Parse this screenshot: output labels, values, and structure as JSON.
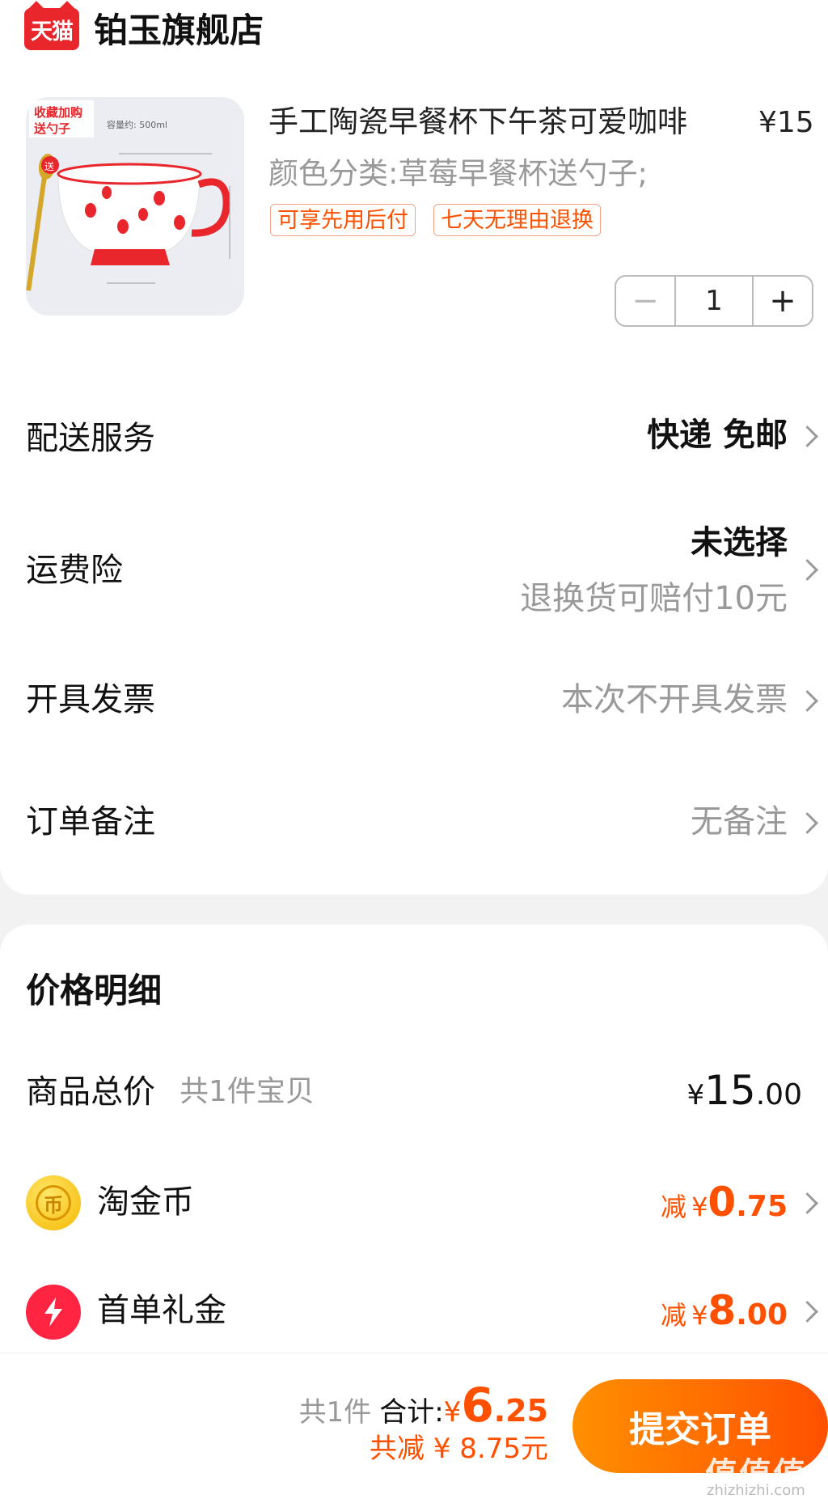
{
  "store": {
    "logo_text": "天猫",
    "name": "铂玉旗舰店"
  },
  "product": {
    "image_labels": {
      "promo": "收藏加购\n送勺子",
      "capacity": "容量约: 500ml",
      "gift": "送"
    },
    "title": "手工陶瓷早餐杯下午茶可爱咖啡",
    "price": "¥15",
    "sku": "颜色分类:草莓早餐杯送勺子;",
    "tags": [
      "可享先用后付",
      "七天无理由退换"
    ],
    "quantity": "1",
    "minus_label": "−",
    "plus_label": "+"
  },
  "rows": {
    "delivery": {
      "label": "配送服务",
      "value": "快递 免邮"
    },
    "insurance": {
      "label": "运费险",
      "value": "未选择",
      "sub": "退换货可赔付10元"
    },
    "invoice": {
      "label": "开具发票",
      "value": "本次不开具发票"
    },
    "remark": {
      "label": "订单备注",
      "value": "无备注"
    }
  },
  "price_detail": {
    "title": "价格明细",
    "total": {
      "label": "商品总价",
      "sub": "共1件宝贝",
      "symbol": "¥",
      "int": "15",
      "dec": ".00"
    },
    "coin": {
      "icon": "币",
      "label": "淘金币",
      "prefix": "减",
      "symbol": "¥",
      "int": "0",
      "dec": ".75"
    },
    "gift": {
      "label": "首单礼金",
      "prefix": "减",
      "symbol": "¥",
      "int": "8",
      "dec": ".00"
    }
  },
  "footer": {
    "count": "共1件",
    "total_label": "合计:",
    "symbol": "¥",
    "total_int": "6",
    "total_dec": ".25",
    "saved": "共减 ¥ 8.75元",
    "submit_label": "提交订单",
    "watermark": "值值值",
    "watermark_url": "zhizhizhi.com"
  },
  "colors": {
    "accent": "#ff5000",
    "tmall_red": "#e8262c",
    "muted": "#999999"
  }
}
